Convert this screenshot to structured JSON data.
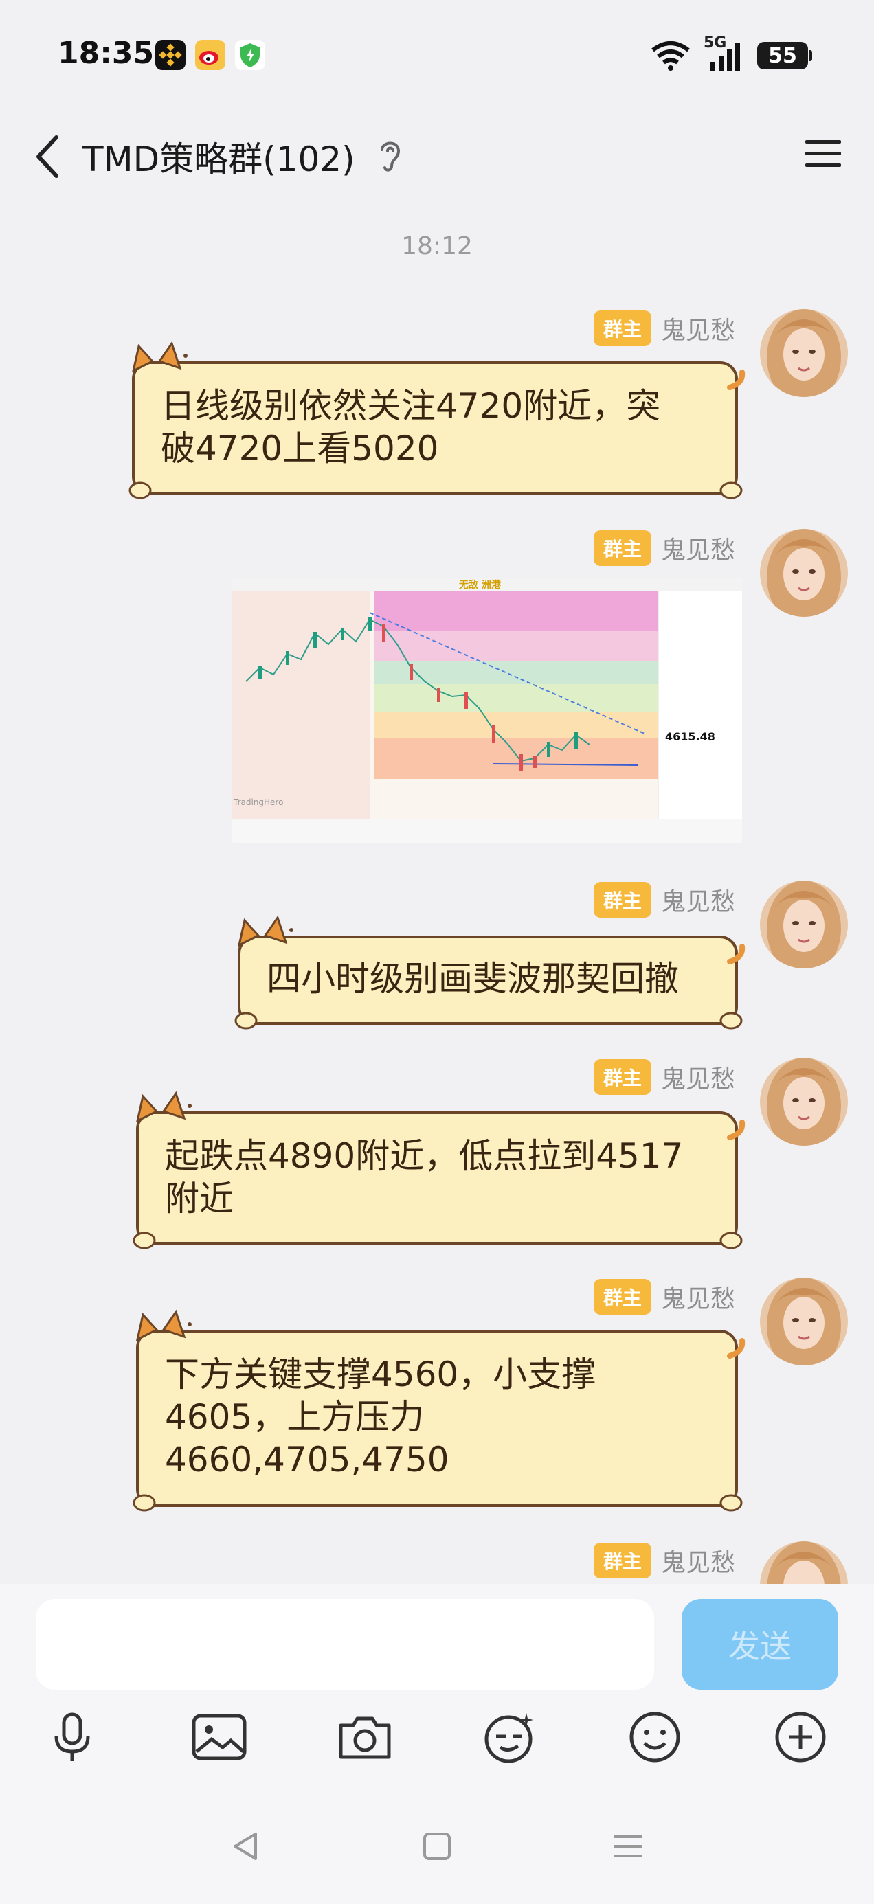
{
  "status_bar": {
    "time": "18:35",
    "network": "5G",
    "battery": "55"
  },
  "header": {
    "title": "TMD策略群(102)"
  },
  "timestamp": "18:12",
  "sender": {
    "badge": "群主",
    "name": "鬼见愁"
  },
  "messages": [
    {
      "line1": "日线级别依然关注4720附近，突",
      "line2": "破4720上看5020"
    },
    {
      "type": "image",
      "chart_label": "无敌 洲港",
      "price": "4615.48",
      "watermark": "TradingHero"
    },
    {
      "line1": "四小时级别画斐波那契回撤"
    },
    {
      "line1": "起跌点4890附近，低点拉到4517",
      "line2": "附近"
    },
    {
      "line1": "下方关键支撑4560，小支撑",
      "line2": "4605，上方压力",
      "line3": "4660,4705,4750"
    }
  ],
  "input": {
    "send_label": "发送"
  },
  "colors": {
    "bubble": "#fdf0c0",
    "bubble_border": "#6b4527",
    "badge": "#f6b93b",
    "send": "#7fc7f5"
  }
}
